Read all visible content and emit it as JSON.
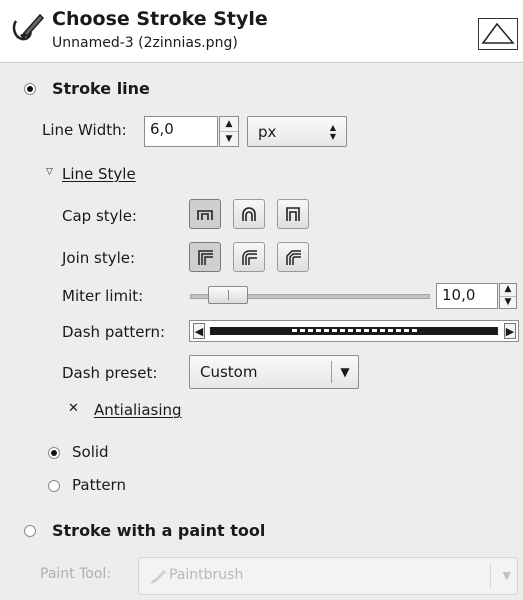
{
  "header": {
    "title": "Choose Stroke Style",
    "subtitle": "Unnamed-3 (2zinnias.png)"
  },
  "stroke_line": {
    "label": "Stroke line",
    "checked": true,
    "line_width": {
      "label": "Line Width:",
      "value": "6,0",
      "unit": "px"
    },
    "line_style": {
      "label": "Line Style",
      "cap_style_label": "Cap style:",
      "join_style_label": "Join style:",
      "miter_limit_label": "Miter limit:",
      "miter_limit_value": "10,0",
      "dash_pattern_label": "Dash pattern:",
      "dash_preset_label": "Dash preset:",
      "dash_preset_value": "Custom",
      "antialiasing_label": "Antialiasing",
      "antialiasing_checked": true
    },
    "fill": {
      "solid_label": "Solid",
      "pattern_label": "Pattern",
      "selected": "Solid"
    }
  },
  "stroke_paint_tool": {
    "label": "Stroke with a paint tool",
    "checked": false,
    "paint_tool_label": "Paint Tool:",
    "paint_tool_value": "Paintbrush"
  }
}
